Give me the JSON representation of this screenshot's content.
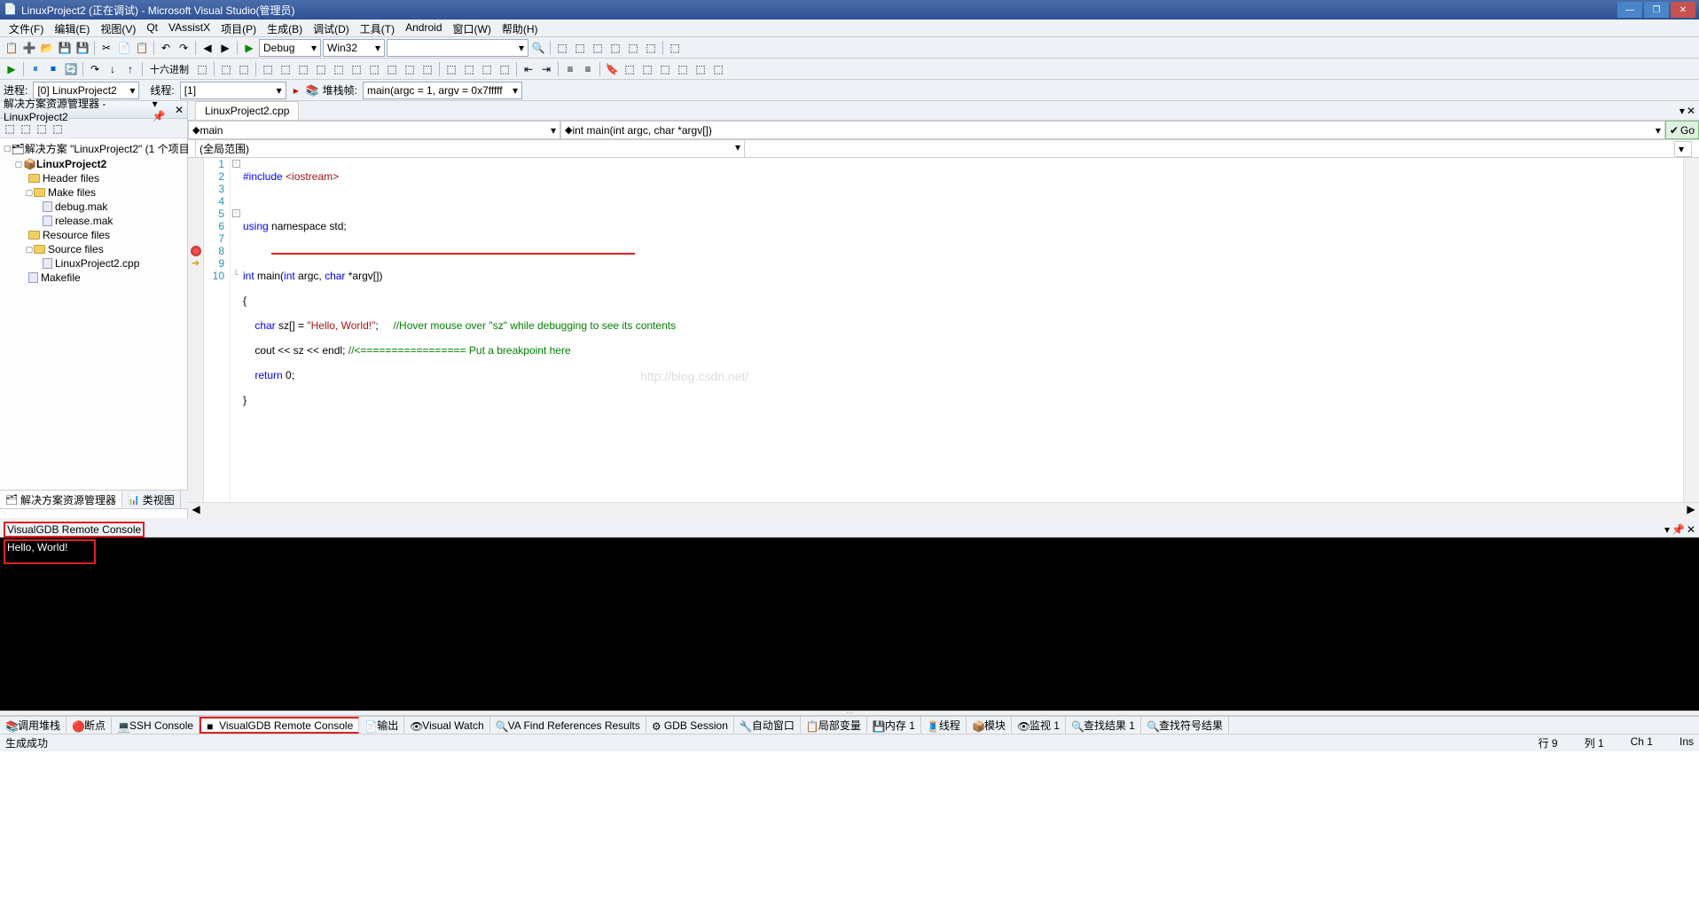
{
  "title": "LinuxProject2 (正在调试) - Microsoft Visual Studio(管理员)",
  "menu": [
    "文件(F)",
    "编辑(E)",
    "视图(V)",
    "Qt",
    "VAssistX",
    "项目(P)",
    "生成(B)",
    "调试(D)",
    "工具(T)",
    "Android",
    "窗口(W)",
    "帮助(H)"
  ],
  "config_combo": "Debug",
  "platform_combo": "Win32",
  "proc_label": "进程:",
  "proc_value": "[0] LinuxProject2",
  "thread_label": "线程:",
  "thread_value": "[1]",
  "stack_label": "堆栈帧:",
  "stack_value": "main(argc = 1, argv = 0x7fffff",
  "hex_label": "十六进制",
  "explorer_title": "解决方案资源管理器 - LinuxProject2",
  "solution_label": "解决方案 \"LinuxProject2\" (1 个项目)",
  "project_name": "LinuxProject2",
  "folders": {
    "header": "Header files",
    "make": "Make files",
    "debug_mak": "debug.mak",
    "release_mak": "release.mak",
    "resource": "Resource files",
    "source": "Source files",
    "cpp": "LinuxProject2.cpp",
    "makefile": "Makefile"
  },
  "sidebar_tabs": {
    "explorer": "解决方案资源管理器",
    "class": "类视图"
  },
  "editor_tab": "LinuxProject2.cpp",
  "scope_dd": "(全局范围)",
  "func_dd1": "main",
  "func_dd2": "int main(int argc, char *argv[])",
  "go_label": "Go",
  "code": {
    "l1_a": "#include ",
    "l1_b": "<iostream>",
    "l3_a": "using",
    "l3_b": " namespace std;",
    "l5_a": "int",
    "l5_b": " main(",
    "l5_c": "int",
    "l5_d": " argc, ",
    "l5_e": "char",
    "l5_f": " *argv[])",
    "l6": "{",
    "l7_a": "    char",
    "l7_b": " sz[] = ",
    "l7_c": "\"Hello, World!\"",
    "l7_d": ";     ",
    "l7_e": "//Hover mouse over \"sz\" while debugging to see its contents",
    "l8_a": "    cout << sz << endl; ",
    "l8_b": "//<================= Put a breakpoint here",
    "l9_a": "    return",
    "l9_b": " 0;",
    "l10": "}"
  },
  "watermark": "http://blog.csdn.net/",
  "console_title": "VisualGDB Remote Console",
  "console_out": "Hello, World!",
  "bottom_tabs": [
    "调用堆栈",
    "断点",
    "SSH Console",
    "VisualGDB Remote Console",
    "输出",
    "Visual Watch",
    "VA Find References Results",
    "GDB Session",
    "自动窗口",
    "局部变量",
    "内存 1",
    "线程",
    "模块",
    "监视 1",
    "查找结果 1",
    "查找符号结果"
  ],
  "status_left": "生成成功",
  "status_line": "行 9",
  "status_col": "列 1",
  "status_ch": "Ch 1",
  "status_ins": "Ins"
}
